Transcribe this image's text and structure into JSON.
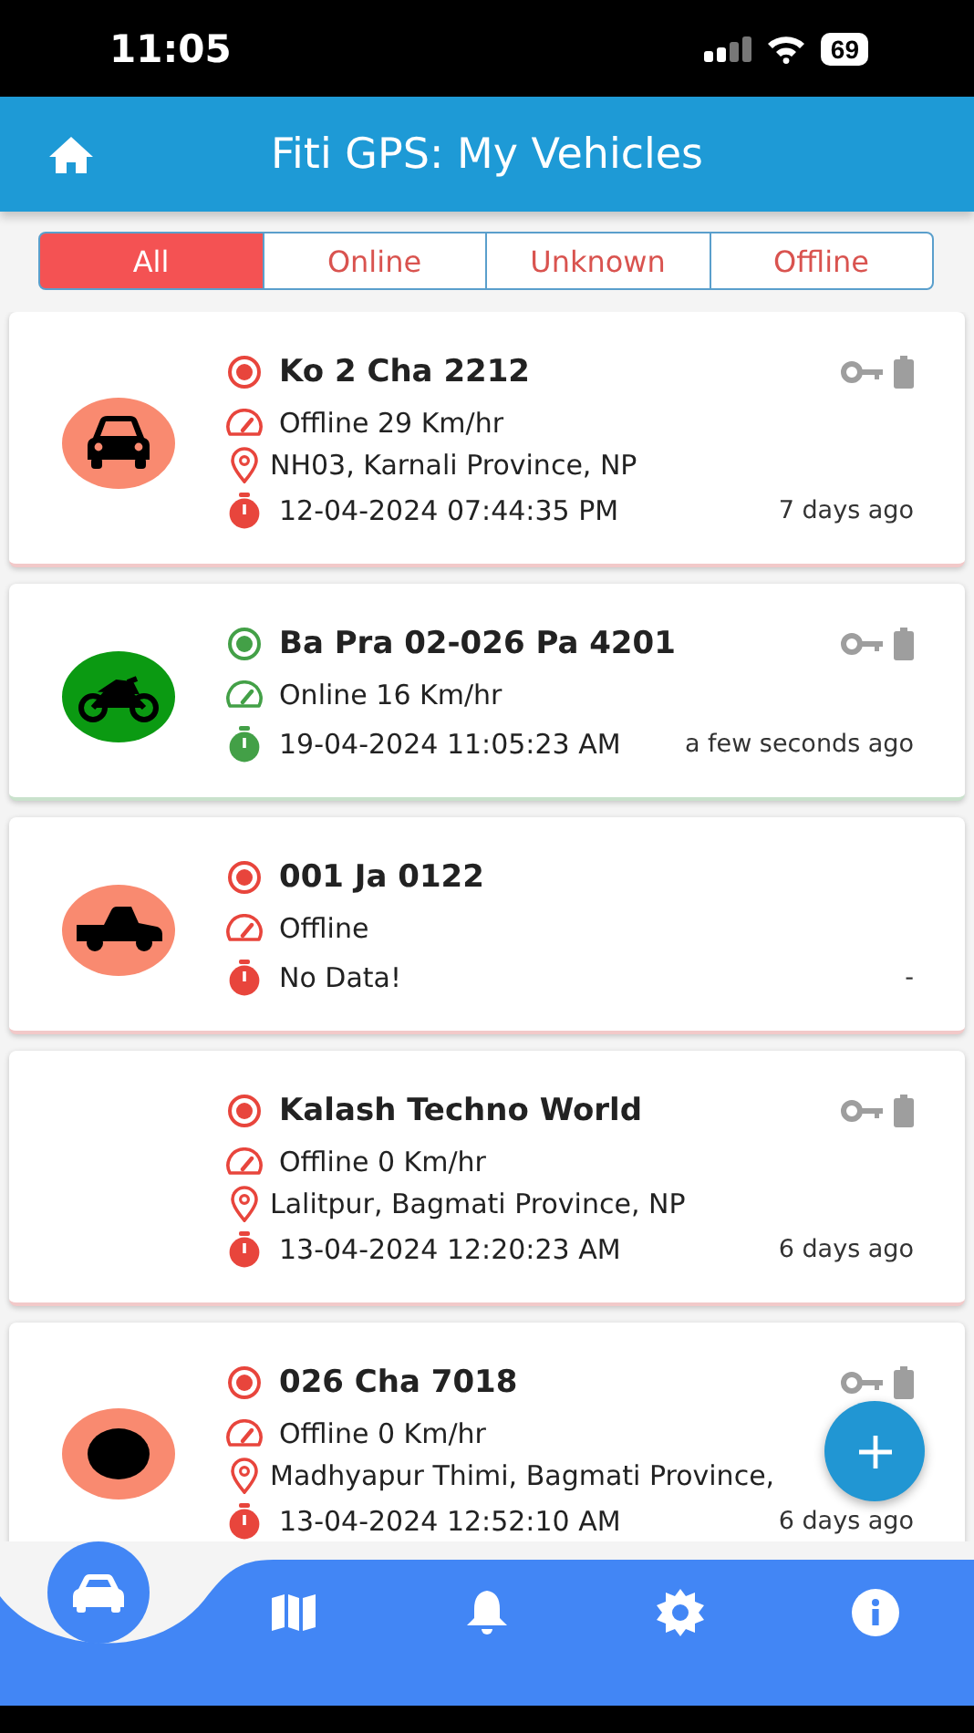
{
  "status_bar": {
    "time": "11:05",
    "battery": "69"
  },
  "header": {
    "title": "Fiti GPS: My Vehicles"
  },
  "tabs": [
    {
      "label": "All",
      "selected": true
    },
    {
      "label": "Online",
      "selected": false
    },
    {
      "label": "Unknown",
      "selected": false
    },
    {
      "label": "Offline",
      "selected": false
    }
  ],
  "vehicles": [
    {
      "name": "Ko 2 Cha 2212",
      "online": false,
      "kind": "car",
      "speed": "Offline 29 Km/hr",
      "address": "NH03, Karnali Province, NP",
      "timestamp": "12-04-2024 07:44:35 PM",
      "ago": "7 days ago",
      "indicators": true
    },
    {
      "name": "Ba Pra 02-026 Pa 4201",
      "online": true,
      "kind": "motorbike",
      "speed": "Online 16 Km/hr",
      "timestamp": "19-04-2024 11:05:23 AM",
      "ago": "a few seconds ago",
      "indicators": true
    },
    {
      "name": "001 Ja 0122",
      "online": false,
      "kind": "pickup",
      "speed": "Offline",
      "timestamp": "No Data!",
      "ago": "-",
      "indicators": false
    },
    {
      "name": "Kalash Techno World",
      "online": false,
      "speed": "Offline 0 Km/hr",
      "address": "Lalitpur, Bagmati Province, NP",
      "timestamp": "13-04-2024 12:20:23 AM",
      "ago": "6 days ago",
      "indicators": true
    },
    {
      "name": "026 Cha 7018",
      "online": false,
      "kind": "dot",
      "speed": "Offline 0 Km/hr",
      "address": "Madhyapur Thimi, Bagmati Province,",
      "timestamp": "13-04-2024 12:52:10 AM",
      "ago": "6 days ago",
      "indicators": true
    }
  ],
  "nav": [
    {
      "kind": "vehicles",
      "selected": true
    },
    {
      "kind": "map",
      "selected": false
    },
    {
      "kind": "alerts",
      "selected": false
    },
    {
      "kind": "settings",
      "selected": false
    },
    {
      "kind": "info",
      "selected": false
    }
  ]
}
